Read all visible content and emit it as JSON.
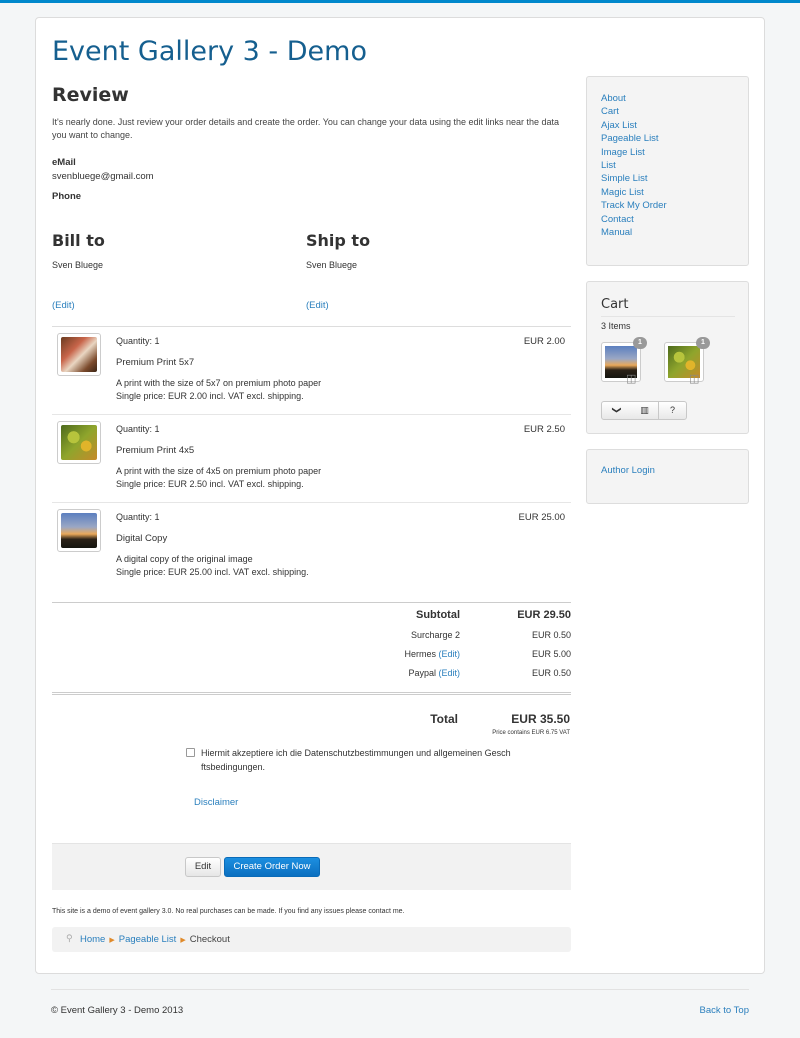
{
  "colors": {
    "accent": "#0088cc",
    "link": "#2a7fbd",
    "title": "#155f8f",
    "button_primary": "#1c8fe0"
  },
  "site": {
    "title": "Event Gallery 3 - Demo"
  },
  "review": {
    "heading": "Review",
    "intro": "It's nearly done. Just review your order details and create the order. You can change your data using the edit links near the data you want to change.",
    "email_label": "eMail",
    "email_value": "svenbluege@gmail.com",
    "phone_label": "Phone"
  },
  "bill_to": {
    "heading": "Bill to",
    "name": "Sven Bluege",
    "edit_label": "(Edit)"
  },
  "ship_to": {
    "heading": "Ship to",
    "name": "Sven Bluege",
    "edit_label": "(Edit)"
  },
  "items": [
    {
      "quantity": "Quantity: 1",
      "name": "Premium Print 5x7",
      "desc1": "A print with the size of 5x7 on premium photo paper",
      "desc2": "Single price: EUR 2.00 incl. VAT excl. shipping.",
      "price": "EUR 2.00"
    },
    {
      "quantity": "Quantity: 1",
      "name": "Premium Print 4x5",
      "desc1": "A print with the size of 4x5 on premium photo paper",
      "desc2": "Single price: EUR 2.50 incl. VAT excl. shipping.",
      "price": "EUR 2.50"
    },
    {
      "quantity": "Quantity: 1",
      "name": "Digital Copy",
      "desc1": "A digital copy of the original image",
      "desc2": "Single price: EUR 25.00 incl. VAT excl. shipping.",
      "price": "EUR 25.00"
    }
  ],
  "totals": {
    "subtotal_label": "Subtotal",
    "subtotal_value": "EUR 29.50",
    "surcharge_label": "Surcharge 2",
    "surcharge_value": "EUR 0.50",
    "shipping_label": "Hermes",
    "shipping_edit": "(Edit)",
    "shipping_value": "EUR 5.00",
    "payment_label": "Paypal",
    "payment_edit": "(Edit)",
    "payment_value": "EUR 0.50",
    "total_label": "Total",
    "total_value": "EUR 35.50",
    "vat_note": "Price contains EUR 6.75 VAT"
  },
  "terms": {
    "checkbox_text": "Hiermit akzeptiere ich die Datenschutzbestimmungen und allgemeinen Gesch     ftsbedingungen.",
    "checked": false,
    "disclaimer": "Disclaimer"
  },
  "actions": {
    "edit_label": "Edit",
    "create_label": "Create Order Now"
  },
  "demo_note": "This site is a demo of event gallery 3.0. No real purchases can be made. If you find any issues please contact me.",
  "breadcrumb": {
    "items": [
      "Home",
      "Pageable List",
      "Checkout"
    ]
  },
  "sidebar": {
    "menu": [
      "About",
      "Cart",
      "Ajax List",
      "Pageable List",
      "Image List",
      "List",
      "Simple List",
      "Magic List",
      "Track My Order",
      "Contact",
      "Manual"
    ],
    "cart": {
      "title": "Cart",
      "count": "3 Items",
      "thumbs": [
        {
          "badge": "1"
        },
        {
          "badge": "1"
        }
      ],
      "buttons": {
        "down": "chevron-down-icon",
        "basket": "basket-icon",
        "help": "?"
      }
    },
    "login": "Author Login"
  },
  "footer": {
    "copyright": "© Event Gallery 3 - Demo 2013",
    "back_to_top": "Back to Top"
  }
}
